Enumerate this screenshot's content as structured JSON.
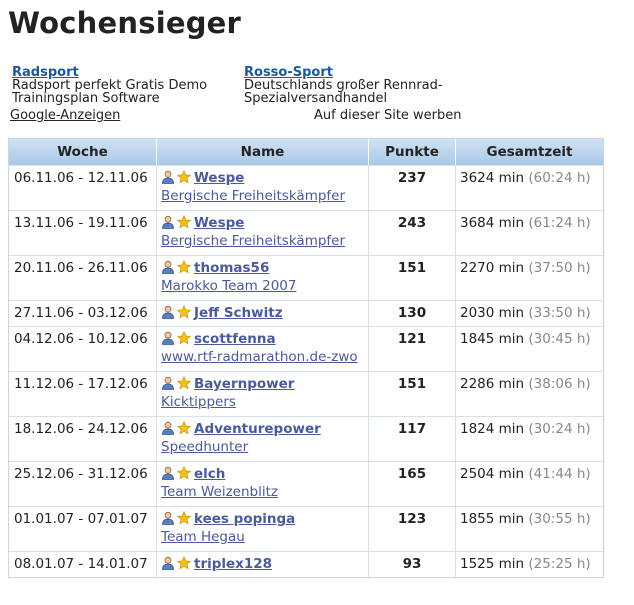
{
  "page": {
    "title": "Wochensieger"
  },
  "ads": {
    "items": [
      {
        "title": "Radsport",
        "lines": [
          "Radsport perfekt Gratis Demo",
          "Trainingsplan Software"
        ]
      },
      {
        "title": "Rosso-Sport",
        "lines": [
          "Deutschlands großer Rennrad-",
          "Spezialversandhandel"
        ]
      }
    ],
    "google_label": "Google-Anzeigen",
    "advertise_label": "Auf dieser Site werben"
  },
  "table": {
    "headers": {
      "week": "Woche",
      "name": "Name",
      "points": "Punkte",
      "time": "Gesamtzeit"
    },
    "rows": [
      {
        "week": "06.11.06 - 12.11.06",
        "user": "Wespe",
        "team": "Bergische Freiheitskämpfer",
        "points": "237",
        "minutes": "3624 min",
        "hours": "(60:24 h)"
      },
      {
        "week": "13.11.06 - 19.11.06",
        "user": "Wespe",
        "team": "Bergische Freiheitskämpfer",
        "points": "243",
        "minutes": "3684 min",
        "hours": "(61:24 h)"
      },
      {
        "week": "20.11.06 - 26.11.06",
        "user": "thomas56",
        "team": "Marokko Team 2007",
        "points": "151",
        "minutes": "2270 min",
        "hours": "(37:50 h)"
      },
      {
        "week": "27.11.06 - 03.12.06",
        "user": "Jeff Schwitz",
        "team": "",
        "points": "130",
        "minutes": "2030 min",
        "hours": "(33:50 h)"
      },
      {
        "week": "04.12.06 - 10.12.06",
        "user": "scottfenna",
        "team": "www.rtf-radmarathon.de-zwo",
        "points": "121",
        "minutes": "1845 min",
        "hours": "(30:45 h)"
      },
      {
        "week": "11.12.06 - 17.12.06",
        "user": "Bayernpower",
        "team": "Kicktippers",
        "points": "151",
        "minutes": "2286 min",
        "hours": "(38:06 h)"
      },
      {
        "week": "18.12.06 - 24.12.06",
        "user": "Adventurepower",
        "team": "Speedhunter",
        "points": "117",
        "minutes": "1824 min",
        "hours": "(30:24 h)"
      },
      {
        "week": "25.12.06 - 31.12.06",
        "user": "elch",
        "team": "Team Weizenblitz",
        "points": "165",
        "minutes": "2504 min",
        "hours": "(41:44 h)"
      },
      {
        "week": "01.01.07 - 07.01.07",
        "user": "kees popinga",
        "team": "Team Hegau",
        "points": "123",
        "minutes": "1855 min",
        "hours": "(30:55 h)"
      },
      {
        "week": "08.01.07 - 14.01.07",
        "user": "triplex128",
        "team": "",
        "points": "93",
        "minutes": "1525 min",
        "hours": "(25:25 h)"
      }
    ]
  },
  "icons": {
    "user": "user-icon",
    "star": "star-icon"
  },
  "colors": {
    "link": "#4a5a9a",
    "ad_link": "#1a5a9a",
    "header_bg": "#b9d3ec",
    "star": "#f2c21b"
  }
}
